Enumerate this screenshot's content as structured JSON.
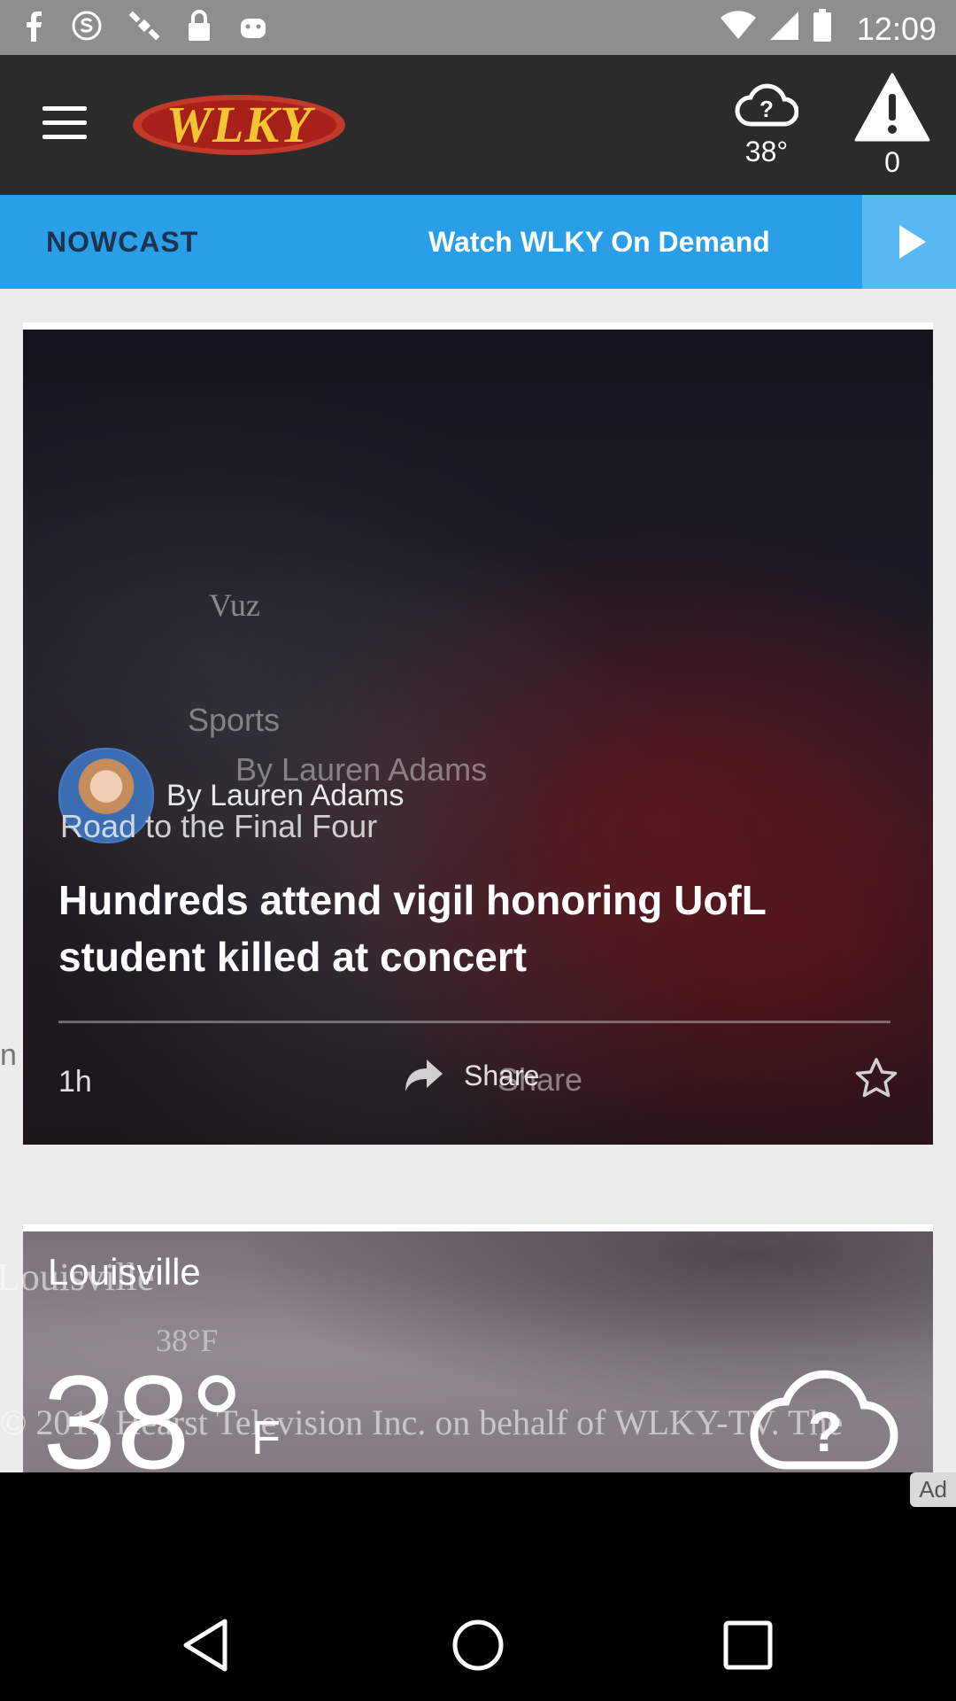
{
  "status_bar": {
    "time": "12:09",
    "icons": [
      "facebook-icon",
      "skype-icon",
      "satellite-icon",
      "lock-icon",
      "android-icon"
    ]
  },
  "app_bar": {
    "logo_text": "WLKY",
    "weather_temp": "38°",
    "alert_count": "0"
  },
  "nowcast_bar": {
    "nowcast_label": "NOWCAST",
    "watch_label": "Watch WLKY On Demand"
  },
  "story": {
    "ghost_top": "Vuz",
    "ghost_sports": "Sports",
    "ghost_byline": "By Lauren Adams",
    "byline": "By Lauren Adams",
    "category": "Road to the Final Four",
    "headline": "Hundreds attend vigil honoring UofL student killed at concert",
    "time_ago": "1h",
    "share_label": "Share",
    "ghost_share": "Share",
    "ghost_left": "n"
  },
  "weather_card": {
    "city": "Louisville",
    "ghost_city": "Louisville",
    "temp_small": "38°F",
    "temp_big": "38°",
    "temp_unit": "F",
    "copyright": "© 2017 Hearst Television Inc. on behalf of WLKY-TV. The"
  },
  "ad": {
    "badge": "Ad"
  },
  "colors": {
    "app_bar": "#2b2b2b",
    "nowcast_bar": "#2a9fe8",
    "logo": "#f5c431"
  }
}
